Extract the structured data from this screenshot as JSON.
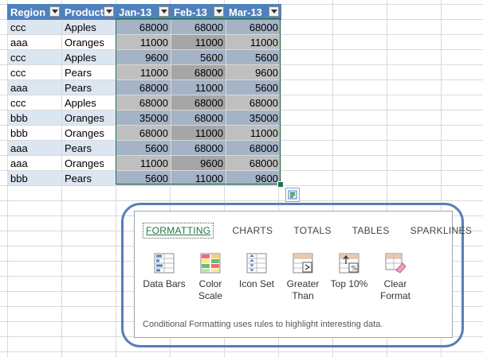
{
  "table": {
    "headers": [
      "Region",
      "Product",
      "Jan-13",
      "Feb-13",
      "Mar-13"
    ],
    "rows": [
      [
        "ccc",
        "Apples",
        "68000",
        "68000",
        "68000"
      ],
      [
        "aaa",
        "Oranges",
        "11000",
        "11000",
        "11000"
      ],
      [
        "ccc",
        "Apples",
        "9600",
        "5600",
        "5600"
      ],
      [
        "ccc",
        "Pears",
        "11000",
        "68000",
        "9600"
      ],
      [
        "aaa",
        "Pears",
        "68000",
        "11000",
        "5600"
      ],
      [
        "ccc",
        "Apples",
        "68000",
        "68000",
        "68000"
      ],
      [
        "bbb",
        "Oranges",
        "35000",
        "68000",
        "35000"
      ],
      [
        "bbb",
        "Oranges",
        "68000",
        "11000",
        "11000"
      ],
      [
        "aaa",
        "Pears",
        "5600",
        "68000",
        "68000"
      ],
      [
        "aaa",
        "Oranges",
        "11000",
        "9600",
        "68000"
      ],
      [
        "bbb",
        "Pears",
        "5600",
        "11000",
        "9600"
      ]
    ]
  },
  "quick_analysis": {
    "tabs": [
      "FORMATTING",
      "CHARTS",
      "TOTALS",
      "TABLES",
      "SPARKLINES"
    ],
    "active_tab": "FORMATTING",
    "options": [
      {
        "label_1": "Data Bars",
        "label_2": "",
        "icon": "data-bars-icon"
      },
      {
        "label_1": "Color",
        "label_2": "Scale",
        "icon": "color-scale-icon"
      },
      {
        "label_1": "Icon Set",
        "label_2": "",
        "icon": "icon-set-icon"
      },
      {
        "label_1": "Greater",
        "label_2": "Than",
        "icon": "greater-than-icon"
      },
      {
        "label_1": "Top 10%",
        "label_2": "",
        "icon": "top-10-percent-icon"
      },
      {
        "label_1": "Clear",
        "label_2": "Format",
        "icon": "clear-format-icon"
      }
    ],
    "description": "Conditional Formatting uses rules to highlight interesting data."
  },
  "colors": {
    "header_blue": "#4f81bd",
    "band_blue": "#dce6f1",
    "selection_green": "#217346",
    "panel_outline": "#5b7db8"
  }
}
